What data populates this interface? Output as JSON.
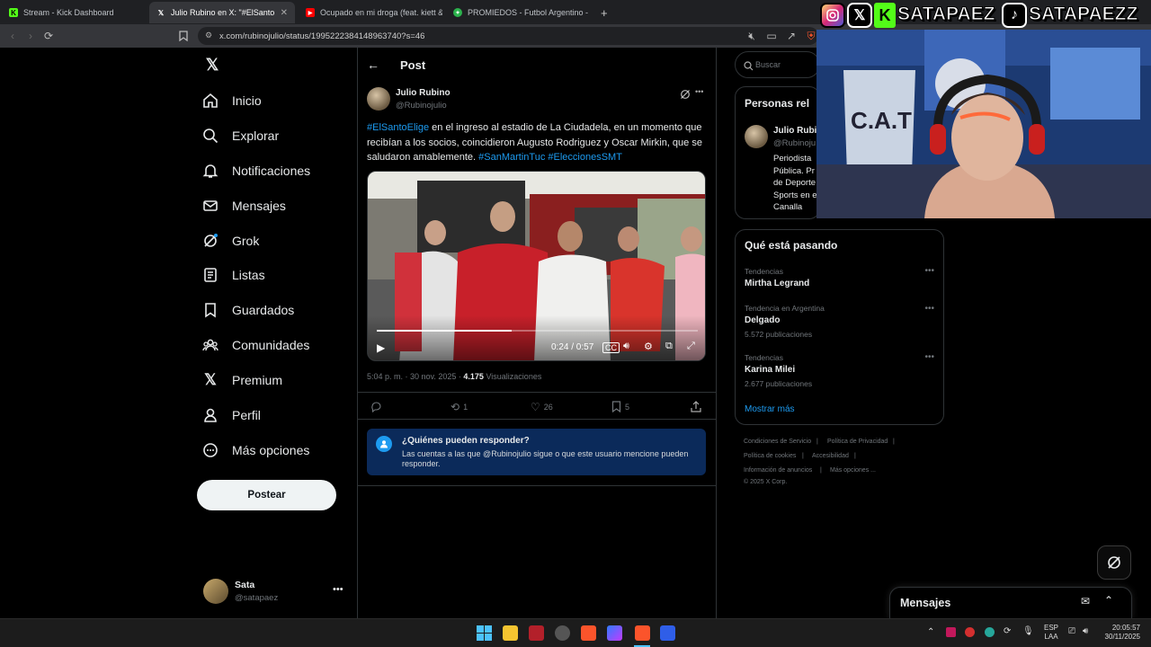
{
  "browser": {
    "tabs": [
      {
        "label": "Stream - Kick Dashboard",
        "active": false
      },
      {
        "label": "Julio Rubino en X: \"#ElSantoElige",
        "active": true
      },
      {
        "label": "Ocupado en mi droga (feat. kiett & q",
        "active": false
      },
      {
        "label": "PROMIEDOS - Futbol Argentino - Fixt",
        "active": false
      }
    ],
    "url": "x.com/rubinojulio/status/1995222384148963740?s=46"
  },
  "overlay": {
    "social_handle_1": "SATAPAEZ",
    "social_handle_2": "SATAPAEZZ"
  },
  "nav": {
    "items": [
      "Inicio",
      "Explorar",
      "Notificaciones",
      "Mensajes",
      "Grok",
      "Listas",
      "Guardados",
      "Comunidades",
      "Premium",
      "Perfil",
      "Más opciones"
    ],
    "post_button": "Postear",
    "account_name": "Sata",
    "account_handle": "@satapaez"
  },
  "post": {
    "header_title": "Post",
    "author_name": "Julio Rubino",
    "author_handle": "@Rubinojulio",
    "hashtag_1": "#ElSantoElige",
    "text": " en el ingreso al estadio de La Ciudadela, en un momento que recibían a los socios,  coincidieron Augusto Rodriguez y Oscar Mirkin, que se saludaron amablemente. ",
    "hashtag_2": "#SanMartinTuc",
    "hashtag_3": "#EleccionesSMT",
    "video_time": "0:24 / 0:57",
    "video_progress": 0.42,
    "timestamp": "5:04 p. m. · 30 nov. 2025 · ",
    "views_count": "4.175",
    "views_label": "Visualizaciones",
    "retweets": "1",
    "likes": "26",
    "bookmarks": "5",
    "reply_title": "¿Quiénes pueden responder?",
    "reply_text": "Las cuentas a las que @Rubinojulio sigue o que este usuario mencione pueden responder."
  },
  "right": {
    "search_placeholder": "Buscar",
    "relevant_title": "Personas rel",
    "relevant_name": "Julio Rubi",
    "relevant_handle": "@Rubinoju",
    "relevant_bio": [
      "Periodista",
      "Pública. Pr",
      "de Deporte",
      "Sports en e",
      "Canalla"
    ],
    "trends_title": "Qué está pasando",
    "trends": [
      {
        "category": "Tendencias",
        "name": "Mirtha Legrand",
        "count": ""
      },
      {
        "category": "Tendencia en Argentina",
        "name": "Delgado",
        "count": "5.572 publicaciones"
      },
      {
        "category": "Tendencias",
        "name": "Karina Milei",
        "count": "2.677 publicaciones"
      }
    ],
    "show_more": "Mostrar más",
    "footer": [
      "Condiciones de Servicio",
      "Política de Privacidad",
      "Política de cookies",
      "Accesibilidad",
      "Información de anuncios",
      "Más opciones ...",
      "© 2025 X Corp."
    ],
    "messages_label": "Mensajes"
  },
  "taskbar": {
    "lang_1": "ESP",
    "lang_2": "LAA",
    "time": "20:05:57",
    "date": "30/11/2025"
  },
  "colors": {
    "accent": "#1d9bf0",
    "background": "#000000",
    "border": "#2f3336",
    "muted": "#71767b"
  }
}
